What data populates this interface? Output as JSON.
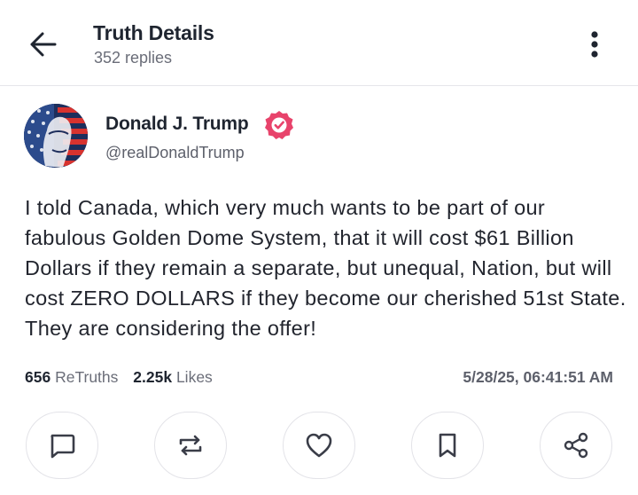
{
  "header": {
    "title": "Truth Details",
    "subtitle": "352 replies",
    "back_icon": "arrow-left-icon",
    "menu_icon": "more-vertical-icon"
  },
  "post": {
    "author": {
      "name": "Donald J. Trump",
      "handle": "@realDonaldTrump",
      "verified": true,
      "verified_color": "#e8436b"
    },
    "text": "I told Canada, which very much wants to be part of our fabulous Golden Dome System, that it will cost $61 Billion Dollars if they remain a separate, but unequal, Nation, but will cost ZERO DOLLARS if they become our cherished 51st State. They are considering the offer!",
    "stats": {
      "retruths_count": "656",
      "retruths_label": "ReTruths",
      "likes_count": "2.25k",
      "likes_label": "Likes"
    },
    "timestamp": "5/28/25, 06:41:51 AM"
  },
  "actions": [
    {
      "name": "reply",
      "icon": "comment-icon"
    },
    {
      "name": "retruth",
      "icon": "repost-icon"
    },
    {
      "name": "like",
      "icon": "heart-icon"
    },
    {
      "name": "bookmark",
      "icon": "bookmark-icon"
    },
    {
      "name": "share",
      "icon": "share-icon"
    }
  ]
}
